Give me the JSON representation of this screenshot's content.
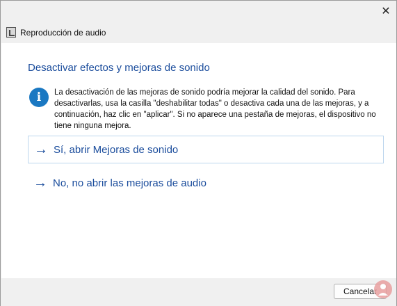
{
  "window": {
    "title": "Reproducción de audio",
    "close_icon": "close-icon"
  },
  "content": {
    "heading": "Desactivar efectos y mejoras de sonido",
    "info_icon_glyph": "i",
    "message": "La desactivación de las mejoras de sonido podría mejorar la calidad del sonido. Para desactivarlas, usa la casilla \"deshabilitar todas\" o desactiva cada una de las mejoras, y a continuación, haz clic en \"aplicar\". Si no aparece una pestaña de mejoras, el dispositivo no tiene ninguna mejora.",
    "options": [
      {
        "label": "Sí, abrir Mejoras de sonido",
        "selected": true
      },
      {
        "label": "No, no abrir las mejoras de audio",
        "selected": false
      }
    ]
  },
  "footer": {
    "cancel_label": "Cancelar"
  },
  "colors": {
    "accent": "#1a4c9c",
    "info_icon": "#1a78c2"
  }
}
